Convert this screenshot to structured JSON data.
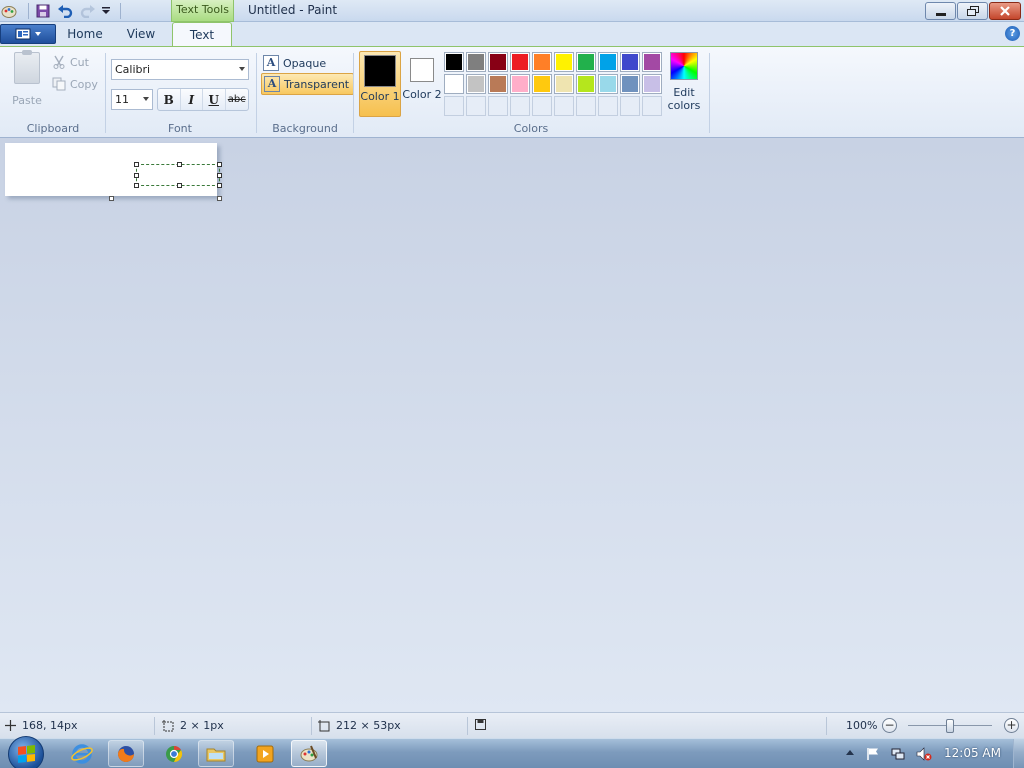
{
  "window": {
    "title": "Untitled - Paint",
    "contextual_tab": "Text Tools"
  },
  "tabs": {
    "home": "Home",
    "view": "View",
    "text": "Text"
  },
  "clipboard": {
    "paste": "Paste",
    "cut": "Cut",
    "copy": "Copy",
    "group_label": "Clipboard"
  },
  "font": {
    "family": "Calibri",
    "size": "11",
    "bold": "B",
    "italic": "I",
    "underline": "U",
    "strikethrough": "abc",
    "group_label": "Font"
  },
  "background": {
    "opaque": "Opaque",
    "transparent": "Transparent",
    "group_label": "Background"
  },
  "colors": {
    "color1_label": "Color 1",
    "color2_label": "Color 2",
    "color1_value": "#000000",
    "color2_value": "#ffffff",
    "edit_label": "Edit colors",
    "group_label": "Colors",
    "palette": [
      "#000000",
      "#7f7f7f",
      "#880015",
      "#ed1c24",
      "#ff7f27",
      "#fff200",
      "#22b14c",
      "#00a2e8",
      "#3f48cc",
      "#a349a4",
      "#ffffff",
      "#c3c3c3",
      "#b97a57",
      "#ffaec9",
      "#ffc90e",
      "#efe4b0",
      "#b5e61d",
      "#99d9ea",
      "#7092be",
      "#c8bfe7",
      "",
      "",
      "",
      "",
      "",
      "",
      "",
      "",
      "",
      ""
    ]
  },
  "status": {
    "cursor_position": "168, 14px",
    "selection_size": "2 × 1px",
    "canvas_size": "212 × 53px",
    "zoom": "100%"
  },
  "taskbar": {
    "clock": "12:05 AM"
  }
}
